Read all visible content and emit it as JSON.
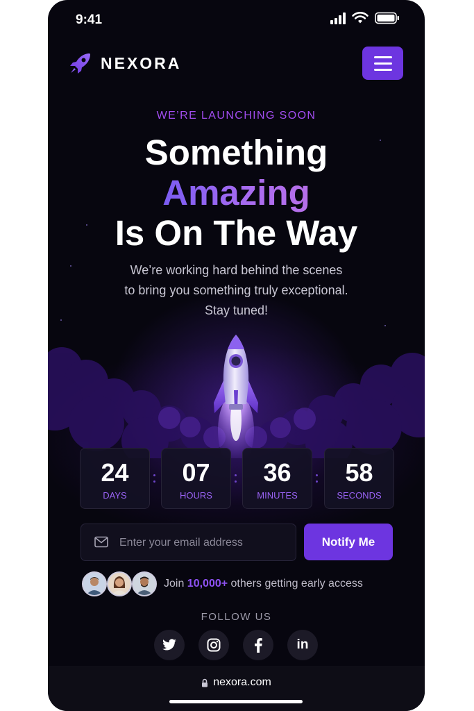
{
  "status_bar": {
    "time": "9:41"
  },
  "brand": {
    "name": "NEXORA",
    "accent_color": "#6d35e0",
    "logo_icon": "rocket-icon"
  },
  "nav": {
    "menu_icon": "hamburger-menu-icon"
  },
  "hero": {
    "eyebrow": "WE’RE LAUNCHING SOON",
    "headline_line1": "Something",
    "headline_line2": "Amazing",
    "headline_line3": "Is On The Way",
    "subtitle_lines": [
      "We’re working hard behind the scenes",
      "to bring you something truly exceptional.",
      "Stay tuned!"
    ]
  },
  "countdown": [
    {
      "value": "24",
      "label": "DAYS"
    },
    {
      "value": "07",
      "label": "HOURS"
    },
    {
      "value": "36",
      "label": "MINUTES"
    },
    {
      "value": "58",
      "label": "SECONDS"
    }
  ],
  "signup": {
    "email_placeholder": "Enter your email address",
    "email_value": "",
    "button_label": "Notify Me"
  },
  "social_proof": {
    "prefix": "Join ",
    "highlight": "10,000+",
    "suffix": " others getting early access"
  },
  "follow": {
    "label": "FOLLOW US",
    "icons": [
      "twitter-icon",
      "instagram-icon",
      "facebook-icon",
      "linkedin-icon"
    ],
    "linkedin_text": "in"
  },
  "browser": {
    "url": "nexora.com"
  }
}
